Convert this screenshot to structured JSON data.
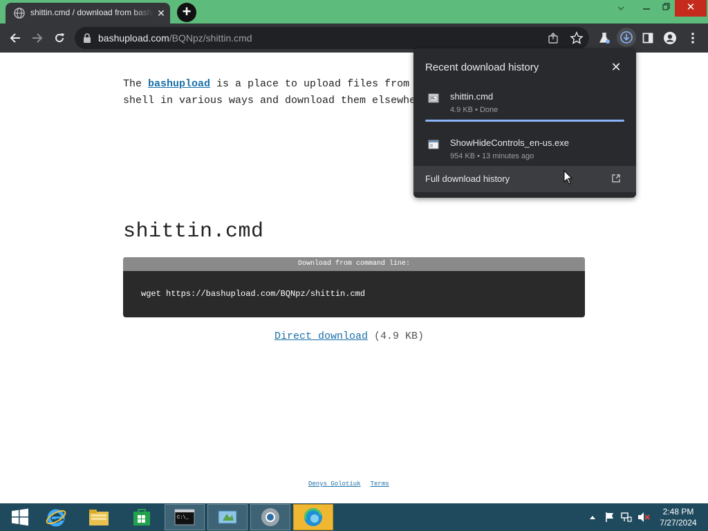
{
  "browser": {
    "tab_title": "shittin.cmd / download from bashupload",
    "url_host": "bashupload.com",
    "url_path": "/BQNpz/shittin.cmd"
  },
  "page": {
    "intro_before": "The ",
    "intro_link": "bashupload",
    "intro_after": " is a place to upload files from your shell in various ways and download them elsewhere.",
    "filename": "shittin.cmd",
    "cmd_header": "Download from command line:",
    "cmd": "wget https://bashupload.com/BQNpz/shittin.cmd",
    "direct_link": "Direct download",
    "direct_size": " (4.9 KB)",
    "footer_author": "Denys Golotiuk",
    "footer_terms": "Terms"
  },
  "downloads": {
    "title": "Recent download history",
    "items": [
      {
        "name": "shittin.cmd",
        "meta": "4.9 KB • Done"
      },
      {
        "name": "ShowHideControls_en-us.exe",
        "meta": "954 KB • 13 minutes ago"
      }
    ],
    "full_history": "Full download history"
  },
  "taskbar": {
    "time": "2:48 PM",
    "date": "7/27/2024"
  },
  "colors": {
    "titlebar": "#5dbb7b",
    "toolbar": "#35363a",
    "popup": "#292a2d",
    "link": "#1a6fa8",
    "taskbar": "#1f4a5e"
  }
}
